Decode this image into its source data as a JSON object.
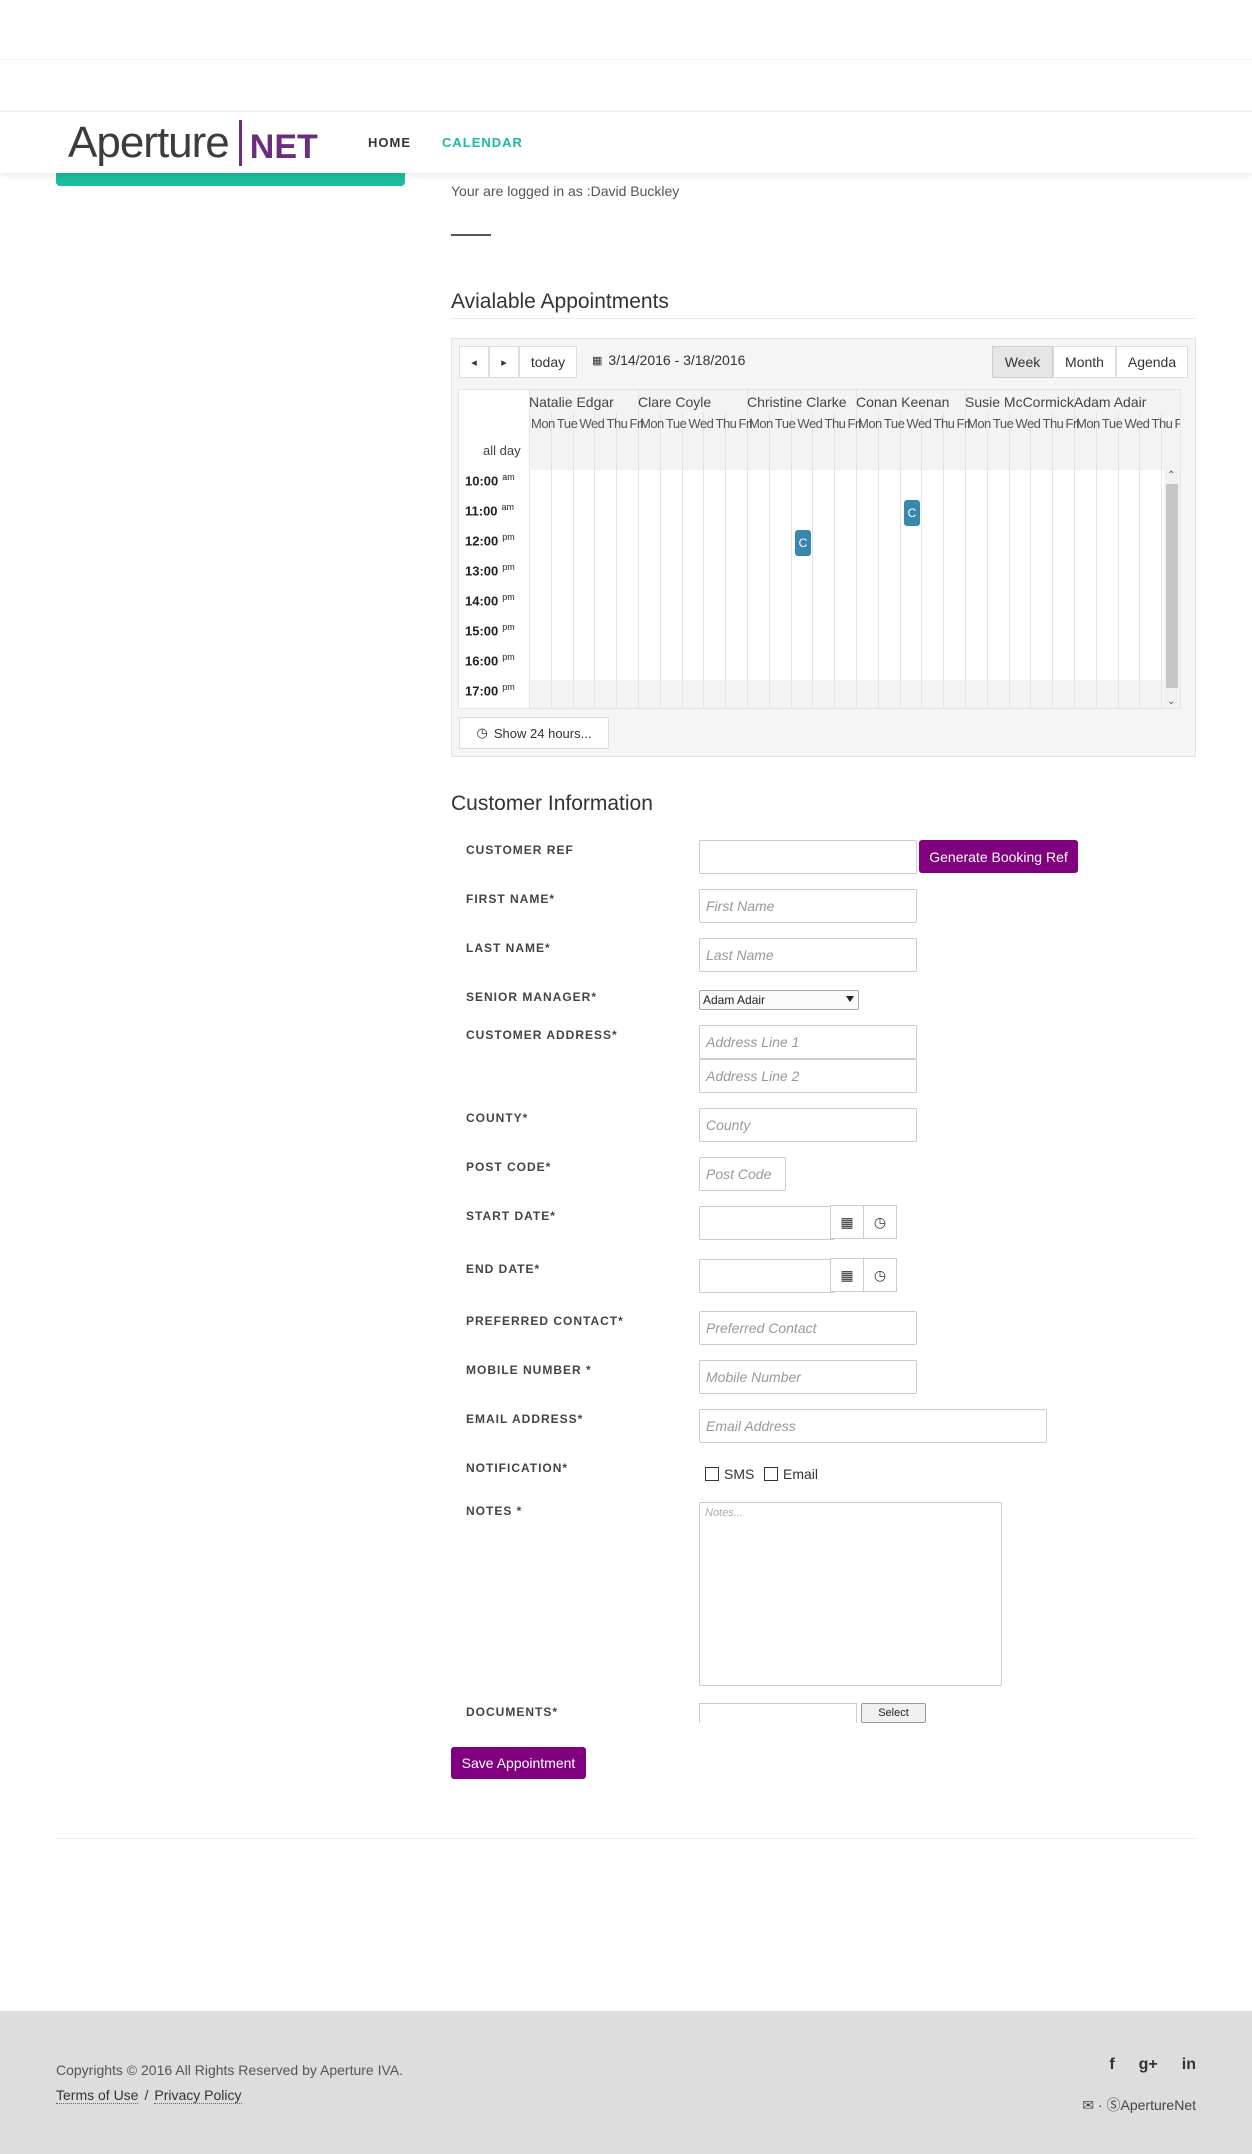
{
  "brand": {
    "logo_main": "Aperture",
    "logo_net": "NET",
    "accent": "#1abc9c",
    "purple": "#800080",
    "event_color": "#3a87ad"
  },
  "nav": {
    "home": "HOME",
    "calendar": "CALENDAR"
  },
  "user": {
    "logged_in_text": "Your are logged in as :David Buckley"
  },
  "appointments": {
    "heading": "Avialable Appointments",
    "toolbar": {
      "prev_icon": "◂",
      "next_icon": "▸",
      "today": "today",
      "date_range": "3/14/2016 - 3/18/2016",
      "week": "Week",
      "month": "Month",
      "agenda": "Agenda",
      "calendar_icon": "📅"
    },
    "resources": [
      "Natalie Edgar",
      "Clare Coyle",
      "Christine Clarke",
      "Conan Keenan",
      "Susie McCormick",
      "Adam Adair"
    ],
    "day_header": "Mon Tue Wed Thu Fri",
    "all_day": "all day",
    "times": [
      {
        "hour": "10:00",
        "period": "am"
      },
      {
        "hour": "11:00",
        "period": "am"
      },
      {
        "hour": "12:00",
        "period": "pm"
      },
      {
        "hour": "13:00",
        "period": "pm"
      },
      {
        "hour": "14:00",
        "period": "pm"
      },
      {
        "hour": "15:00",
        "period": "pm"
      },
      {
        "hour": "16:00",
        "period": "pm"
      },
      {
        "hour": "17:00",
        "period": "pm"
      }
    ],
    "event_label": "C",
    "show_24": "Show 24 hours..."
  },
  "customer": {
    "heading": "Customer Information",
    "labels": {
      "ref": "CUSTOMER REF",
      "first": "FIRST NAME*",
      "last": "LAST NAME*",
      "manager": "SENIOR MANAGER*",
      "address": "CUSTOMER ADDRESS*",
      "county": "COUNTY*",
      "postcode": "POST CODE*",
      "start": "START DATE*",
      "end": "END DATE*",
      "contact": "PREFERRED CONTACT*",
      "mobile": "MOBILE NUMBER *",
      "email": "EMAIL ADDRESS*",
      "notification": "NOTIFICATION*",
      "notes": "NOTES *",
      "documents": "DOCUMENTS*"
    },
    "placeholders": {
      "first": "First Name",
      "last": "Last Name",
      "addr1": "Address Line 1",
      "addr2": "Address Line 2",
      "county": "County",
      "postcode": "Post Code",
      "contact": "Preferred Contact",
      "mobile": "Mobile Number",
      "email": "Email Address",
      "notes": "Notes..."
    },
    "generate_btn": "Generate Booking Ref",
    "manager_selected": "Adam Adair",
    "sms": "SMS",
    "email_opt": "Email",
    "select_btn": "Select",
    "save_btn": "Save Appointment"
  },
  "footer": {
    "copyright": "Copyrights © 2016 All Rights Reserved by Aperture IVA.",
    "terms": "Terms of Use",
    "sep": "/",
    "privacy": "Privacy Policy",
    "social": [
      "f",
      "g+",
      "in"
    ],
    "contact": "✉ · ⓈApertureNet"
  }
}
